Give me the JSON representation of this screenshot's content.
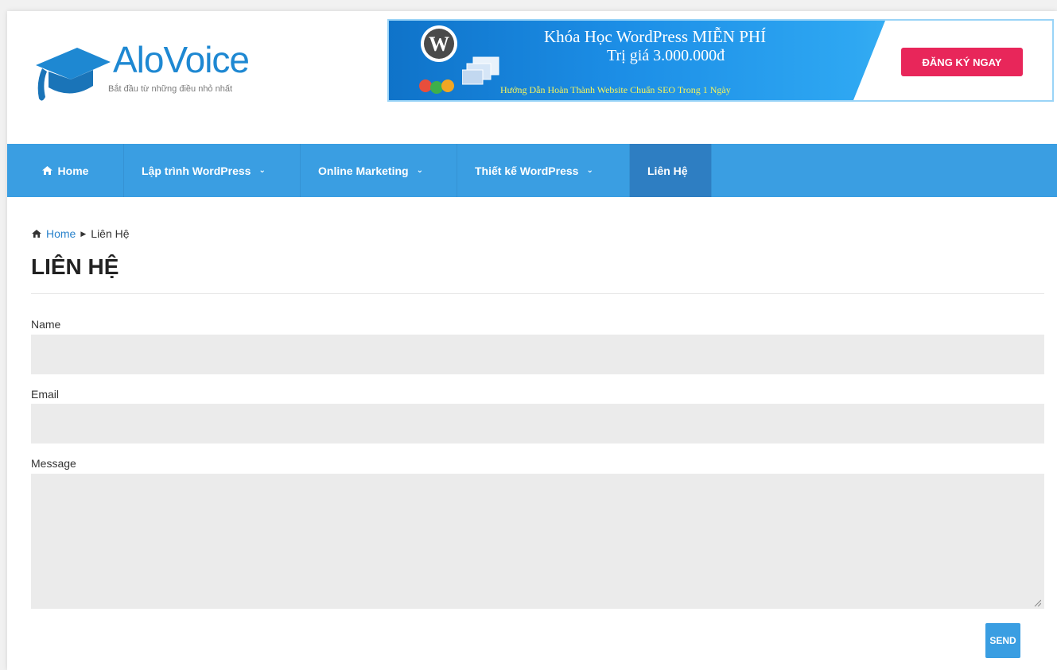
{
  "header": {
    "logo_text": "AloVoice",
    "logo_tagline": "Bắt đầu từ những điều nhỏ nhất"
  },
  "banner": {
    "line1": "Khóa Học WordPress MIỄN PHÍ",
    "line2": "Trị giá 3.000.000đ",
    "line3": "Hướng Dẫn Hoàn Thành Website Chuẩn SEO Trong 1 Ngày",
    "cta": "ĐĂNG KÝ NGAY"
  },
  "nav": {
    "home": "Home",
    "items": [
      {
        "label": "Lập trình WordPress"
      },
      {
        "label": "Online Marketing"
      },
      {
        "label": "Thiết kế WordPress"
      },
      {
        "label": "Liên Hệ"
      }
    ]
  },
  "breadcrumb": {
    "home": "Home",
    "current": "Liên Hệ"
  },
  "page_title": "LIÊN HỆ",
  "form": {
    "name_label": "Name",
    "email_label": "Email",
    "message_label": "Message",
    "send_label": "SEND"
  },
  "colors": {
    "brand_blue": "#1e88d2",
    "nav_bg": "#3a9ee2",
    "nav_active": "#2e7ec2",
    "cta_red": "#e8265a",
    "field_bg": "#ebebeb"
  }
}
